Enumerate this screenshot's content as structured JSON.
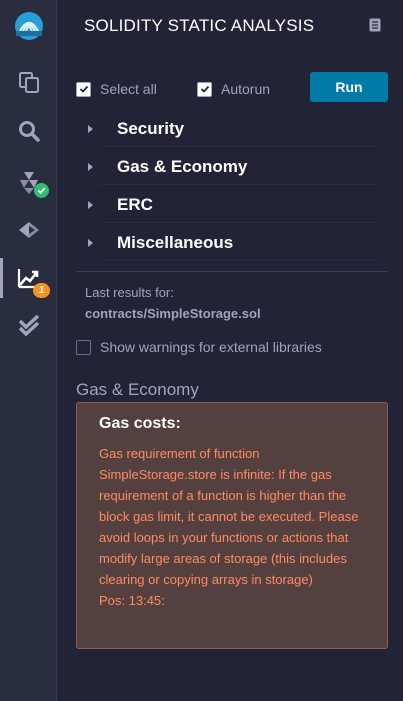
{
  "iconbar": {
    "items": [
      {
        "icon": "remix-logo-icon"
      },
      {
        "icon": "file-explorer-icon"
      },
      {
        "icon": "search-icon"
      },
      {
        "icon": "solidity-compiler-icon",
        "badge": "check"
      },
      {
        "icon": "deploy-run-icon"
      },
      {
        "icon": "static-analysis-icon",
        "badge": "1"
      },
      {
        "icon": "unit-testing-icon"
      }
    ],
    "colors": {
      "badge_check": "#2fbf71",
      "badge_count": "#f7931e"
    }
  },
  "header": {
    "title": "SOLIDITY STATIC ANALYSIS",
    "doc_icon": "book-icon"
  },
  "controls": {
    "select_all": {
      "label": "Select all",
      "checked": true
    },
    "autorun": {
      "label": "Autorun",
      "checked": true
    },
    "run_label": "Run"
  },
  "categories": [
    {
      "label": "Security"
    },
    {
      "label": "Gas & Economy"
    },
    {
      "label": "ERC"
    },
    {
      "label": "Miscellaneous"
    }
  ],
  "results": {
    "last_results_label": "Last results for:",
    "file": "contracts/SimpleStorage.sol",
    "show_warnings_label": "Show warnings for external libraries",
    "show_warnings_checked": false
  },
  "section": {
    "title": "Gas & Economy",
    "alert": {
      "title": "Gas costs:",
      "message": "Gas requirement of function SimpleStorage.store is infinite: If the gas requirement of a function is higher than the block gas limit, it cannot be executed. Please avoid loops in your functions or actions that modify large areas of storage (this includes clearing or copying arrays in storage)",
      "position": "Pos: 13:45:"
    }
  },
  "colors": {
    "accent": "#007aa6",
    "warning_text": "#ff8b62",
    "warning_bg": "#54403f"
  }
}
